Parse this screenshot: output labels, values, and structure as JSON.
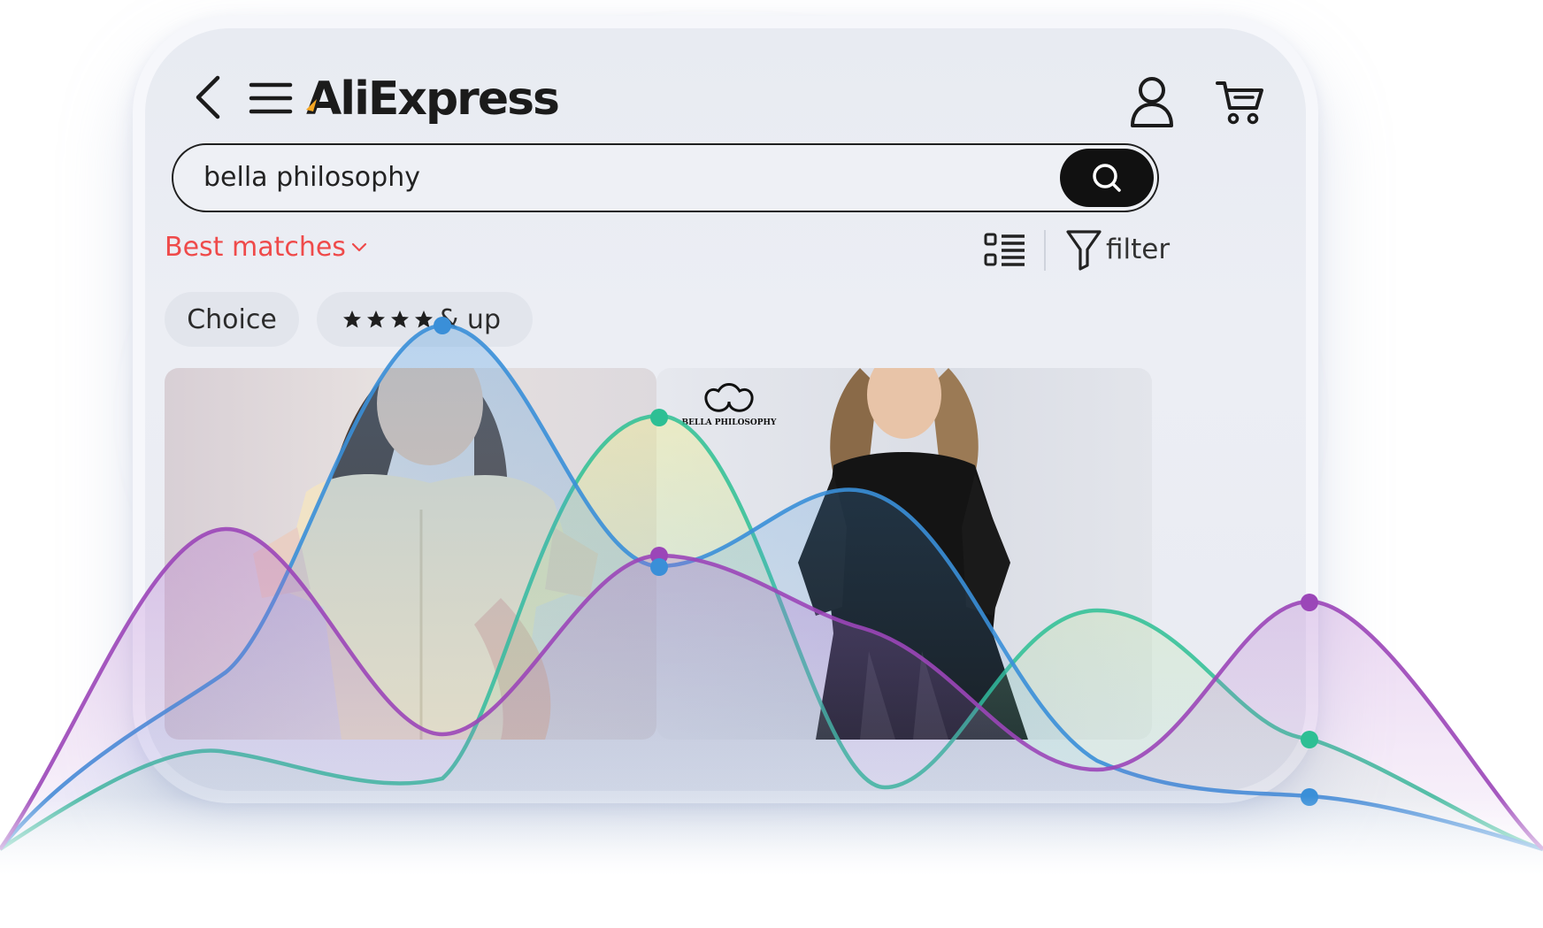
{
  "header": {
    "logo_text": "AliExpress",
    "logo_accent_color": "#f5a623"
  },
  "search": {
    "value": "bella philosophy"
  },
  "sort": {
    "label": "Best matches"
  },
  "filter": {
    "label": "filter"
  },
  "chips": {
    "choice": "Choice",
    "rating_suffix": "& up",
    "rating_stars": 4
  },
  "products": [
    {
      "brand_logo": "BELLA PHILOSOPHY"
    }
  ],
  "colors": {
    "accent_red": "#ef4a4a",
    "series_blue": "#3a8fd8",
    "series_green": "#2dbf94",
    "series_purple": "#9b46b8"
  },
  "icons": [
    "back-icon",
    "menu-icon",
    "account-icon",
    "cart-icon",
    "search-icon",
    "list-view-icon",
    "filter-icon",
    "star-icon",
    "chevron-down-icon"
  ]
}
